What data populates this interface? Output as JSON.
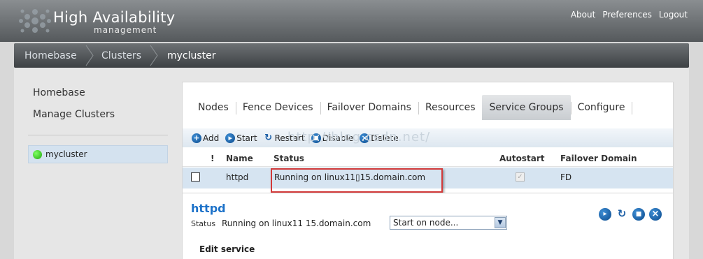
{
  "app": {
    "title": "High Availability",
    "subtitle": "management"
  },
  "toplinks": [
    "About",
    "Preferences",
    "Logout"
  ],
  "breadcrumb": [
    "Homebase",
    "Clusters",
    "mycluster"
  ],
  "sidebar": {
    "links": [
      "Homebase",
      "Manage Clusters"
    ],
    "cluster": {
      "name": "mycluster",
      "status_color": "#2ec413"
    }
  },
  "tabs": [
    {
      "label": "Nodes",
      "active": false
    },
    {
      "label": "Fence Devices",
      "active": false
    },
    {
      "label": "Failover Domains",
      "active": false
    },
    {
      "label": "Resources",
      "active": false
    },
    {
      "label": "Service Groups",
      "active": true
    },
    {
      "label": "Configure",
      "active": false
    }
  ],
  "toolbar": {
    "add": "Add",
    "start": "Start",
    "restart": "Restart",
    "disable": "Disable",
    "delete": "Delete",
    "watermark": "http://blog.csdn.net/"
  },
  "table": {
    "headers": {
      "flag": "!",
      "name": "Name",
      "status": "Status",
      "autostart": "Autostart",
      "domain": "Failover Domain"
    },
    "rows": [
      {
        "name": "httpd",
        "status": "Running on linux11▯15.domain.com",
        "autostart": true,
        "domain": "FD"
      }
    ]
  },
  "details": {
    "title": "httpd",
    "status_label": "Status",
    "status_value": "Running on linux11  15.domain.com",
    "select_value": "Start on node...",
    "edit_label": "Edit service"
  },
  "colors": {
    "accent": "#1d72c9",
    "highlight": "#d6e4f1",
    "annotation": "#d23a3a"
  }
}
